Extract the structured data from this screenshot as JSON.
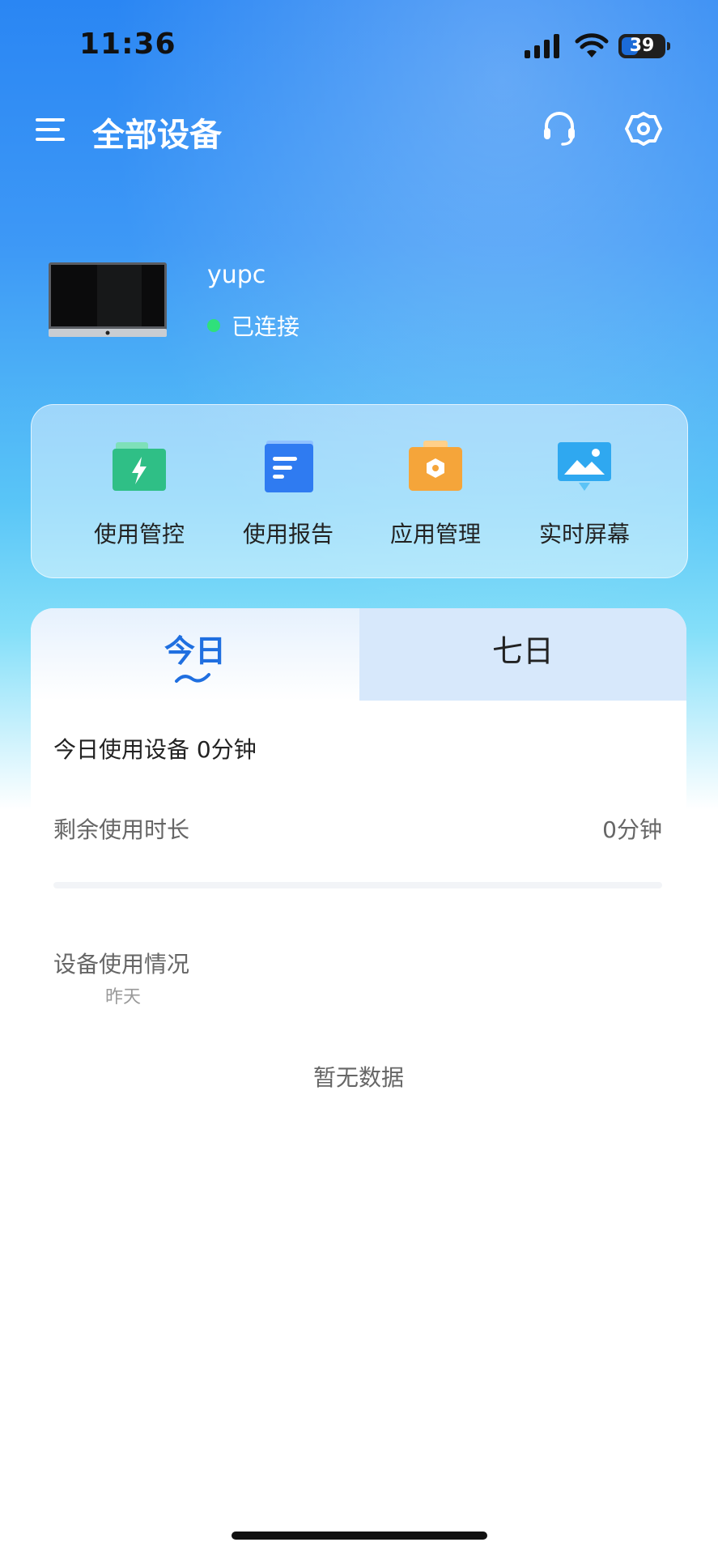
{
  "status_bar": {
    "time": "11:36",
    "battery": "39",
    "battery_level": 0.39
  },
  "header": {
    "title": "全部设备"
  },
  "device": {
    "name": "yupc",
    "status": "已连接"
  },
  "quick_actions": [
    {
      "label": "使用管控",
      "icon": "lightning-folder-icon",
      "color": "#36c48e"
    },
    {
      "label": "使用报告",
      "icon": "report-document-icon",
      "color": "#2f7bf1"
    },
    {
      "label": "应用管理",
      "icon": "app-folder-icon",
      "color": "#f5a53a"
    },
    {
      "label": "实时屏幕",
      "icon": "screen-image-icon",
      "color": "#2fa8f0"
    }
  ],
  "tabs": [
    {
      "label": "今日",
      "active": true
    },
    {
      "label": "七日",
      "active": false
    }
  ],
  "stats": {
    "today_usage": "今日使用设备 0分钟",
    "remaining_label": "剩余使用时长",
    "remaining_value": "0分钟",
    "usage_title": "设备使用情况",
    "usage_subtitle": "昨天",
    "empty_text": "暂无数据"
  },
  "colors": {
    "accent": "#1f6fe0",
    "online": "#2fe07b"
  }
}
